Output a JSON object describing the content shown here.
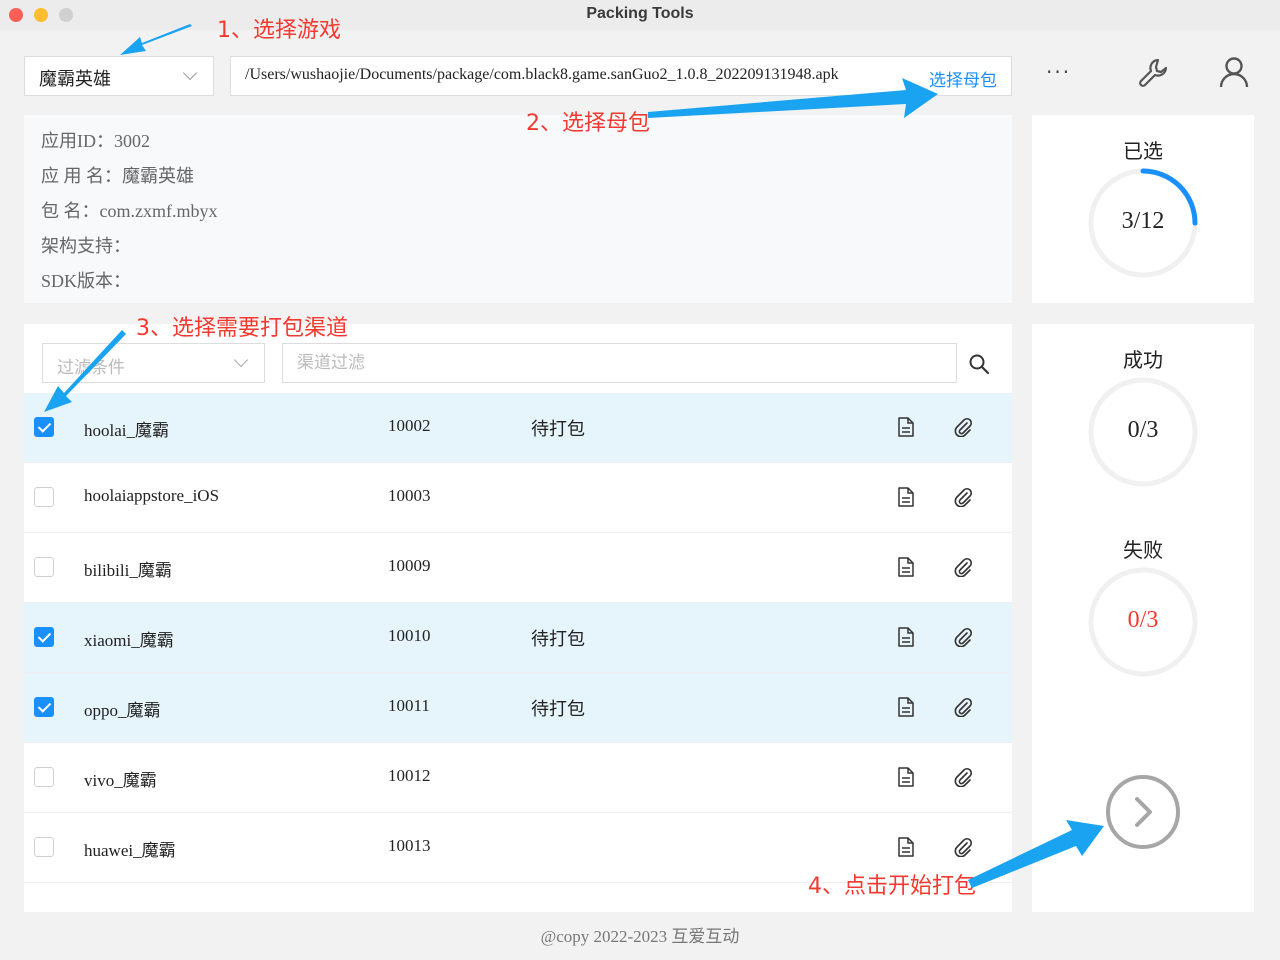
{
  "window": {
    "title": "Packing Tools"
  },
  "toolbar": {
    "game_select": "魔霸英雄",
    "apk_path": "/Users/wushaojie/Documents/package/com.black8.game.sanGuo2_1.0.8_202209131948.apk",
    "pick_apk_label": "选择母包",
    "more_icon": "more-icon",
    "tools_icon": "wrench-icon",
    "account_icon": "user-icon"
  },
  "info": {
    "app_id": "应用ID：3002",
    "app_name": "应 用 名：魔霸英雄",
    "package_name": "包 名：com.zxmf.mbyx",
    "arch": "架构支持：",
    "sdk_version": "SDK版本："
  },
  "stats": {
    "selected_label": "已选",
    "selected_value": "3/12",
    "selected_fraction": 0.25,
    "success_label": "成功",
    "success_value": "0/3",
    "fail_label": "失败",
    "fail_value": "0/3",
    "accent_color": "#1a90ff",
    "fail_color": "#f23a30"
  },
  "filter": {
    "condition_placeholder": "过滤条件",
    "channel_placeholder": "渠道过滤"
  },
  "channels": [
    {
      "name": "hoolai_魔霸",
      "id": "10002",
      "status": "待打包",
      "checked": true
    },
    {
      "name": "hoolaiappstore_iOS",
      "id": "10003",
      "status": "",
      "checked": false
    },
    {
      "name": "bilibili_魔霸",
      "id": "10009",
      "status": "",
      "checked": false
    },
    {
      "name": "xiaomi_魔霸",
      "id": "10010",
      "status": "待打包",
      "checked": true
    },
    {
      "name": "oppo_魔霸",
      "id": "10011",
      "status": "待打包",
      "checked": true
    },
    {
      "name": "vivo_魔霸",
      "id": "10012",
      "status": "",
      "checked": false
    },
    {
      "name": "huawei_魔霸",
      "id": "10013",
      "status": "",
      "checked": false
    }
  ],
  "footer": "@copy 2022-2023 互爱互动",
  "annotations": {
    "step1": "1、选择游戏",
    "step2": "2、选择母包",
    "step3": "3、选择需要打包渠道",
    "step4": "4、点击开始打包",
    "color": "#f23a30",
    "arrow_color": "#1aa3f0"
  }
}
